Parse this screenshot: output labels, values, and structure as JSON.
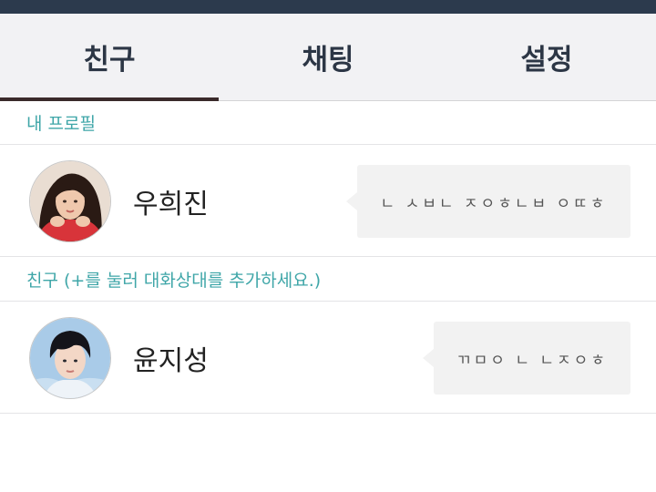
{
  "tabs": [
    {
      "label": "친구",
      "active": true
    },
    {
      "label": "채팅",
      "active": false
    },
    {
      "label": "설정",
      "active": false
    }
  ],
  "my_profile": {
    "header": "내 프로필",
    "name": "우희진",
    "status_message": "ㄴ ㅅㅂㄴ ㅈㅇㅎㄴㅂ ㅇㄸㅎ",
    "avatar_icon": "profile-photo-woman"
  },
  "friends": {
    "header": "친구 (+를 눌러 대화상대를 추가하세요.)",
    "items": [
      {
        "name": "윤지성",
        "status_message": "ㄲㅁㅇ ㄴ ㄴㅈㅇㅎ",
        "avatar_icon": "profile-photo-man"
      }
    ]
  },
  "colors": {
    "status_bar": "#2c3a4d",
    "tab_bar_bg": "#f2f2f4",
    "tab_text": "#2c3645",
    "active_indicator": "#3a2a2a",
    "section_header": "#3fa6a8",
    "bubble_bg": "#f2f2f2"
  }
}
